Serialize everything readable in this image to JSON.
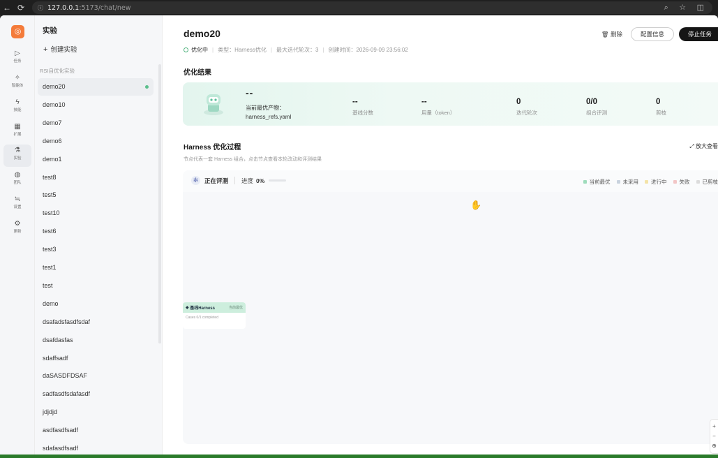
{
  "browser": {
    "back_icon": "←",
    "reload_icon": "⟳",
    "url_host": "127.0.0.1",
    "url_path": ":5173/chat/new",
    "right_icons": "⌕ ☆ ◫"
  },
  "rail": {
    "logo": "◎",
    "items": [
      {
        "label": "任务",
        "icon": "▷"
      },
      {
        "label": "智能体",
        "icon": "✧"
      },
      {
        "label": "技能",
        "icon": "ϟ"
      },
      {
        "label": "扩展",
        "icon": "▦"
      },
      {
        "label": "实验",
        "icon": "⚗"
      },
      {
        "label": "团队",
        "icon": "◍"
      },
      {
        "label": "设置",
        "icon": "≒"
      },
      {
        "label": "更新",
        "icon": "⚙"
      }
    ]
  },
  "sidebar": {
    "title": "实验",
    "create_label": "创建实验",
    "section_label": "RSI自优化实验",
    "items": [
      "demo20",
      "demo10",
      "demo7",
      "demo6",
      "demo1",
      "test8",
      "test5",
      "test10",
      "test6",
      "test3",
      "test1",
      "test",
      "demo",
      "dsafadsfasdfsdaf",
      "dsafdasfas",
      "sdaffsadf",
      "daSASDFDSAF",
      "sadfasdfsdafasdf",
      "jdjdjd",
      "asdfasdfsadf",
      "sdafasdfsadf"
    ]
  },
  "header": {
    "title": "demo20",
    "status": "优化中",
    "type_text": "类型：Harness优化",
    "max_iter_text": "最大迭代轮次：3",
    "created_text": "创建时间：2026-09-09 23:56:02",
    "delete_label": "删除",
    "config_label": "配置信息",
    "stop_label": "停止任务"
  },
  "result": {
    "heading": "优化结果",
    "best_value": "--",
    "best_label": "当前最优产物：",
    "best_file": "harness_refs.yaml",
    "stats": [
      {
        "value": "--",
        "label": "基线分数"
      },
      {
        "value": "--",
        "label": "用量（token）"
      },
      {
        "value": "0",
        "label": "迭代轮次"
      },
      {
        "value": "0/0",
        "label": "组合评测"
      },
      {
        "value": "0",
        "label": "剪枝"
      }
    ]
  },
  "process": {
    "heading": "Harness 优化过程",
    "expand_label": "放大查看",
    "desc": "节点代表一套 Harness 组合，点击节点查看本轮改动和评测结果",
    "eval_label": "正在评测",
    "progress_label": "进度",
    "progress_value": "0%",
    "progress_fraction": 0,
    "legend": [
      {
        "label": "当前最优",
        "color": "#9fdcbc"
      },
      {
        "label": "未采用",
        "color": "#c9d3de"
      },
      {
        "label": "进行中",
        "color": "#f3e3a8"
      },
      {
        "label": "失败",
        "color": "#f2c6c6"
      },
      {
        "label": "已剪枝",
        "color": "#dcdcdc"
      }
    ],
    "node": {
      "title": "基线Harness",
      "tag": "当前最优",
      "body": "Cases 0/1 completed"
    },
    "zoom": [
      "+",
      "−",
      "⊕"
    ]
  }
}
